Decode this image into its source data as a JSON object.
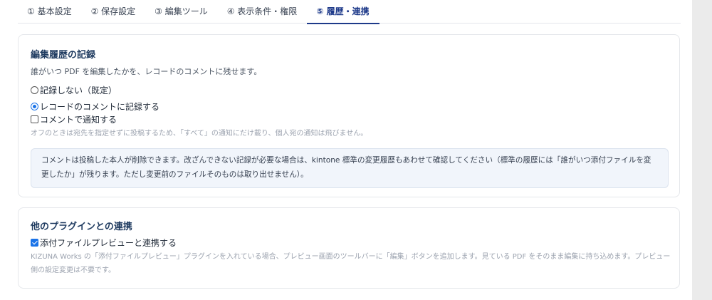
{
  "tabs": [
    {
      "label": "① 基本設定",
      "active": false
    },
    {
      "label": "② 保存設定",
      "active": false
    },
    {
      "label": "③ 編集ツール",
      "active": false
    },
    {
      "label": "④ 表示条件・権限",
      "active": false
    },
    {
      "label": "⑤ 履歴・連携",
      "active": true
    }
  ],
  "history": {
    "title": "編集履歴の記録",
    "description": "誰がいつ PDF を編集したかを、レコードのコメントに残せます。",
    "options": {
      "no_record": {
        "label": "記録しない（既定）",
        "checked": false
      },
      "record_comment": {
        "label": "レコードのコメントに記録する",
        "checked": true
      },
      "notify_comment": {
        "label": "コメントで通知する",
        "checked": false
      }
    },
    "hint": "オフのときは宛先を指定せずに投稿するため、「すべて」の通知にだけ載り、個人宛の通知は飛びません。",
    "note": "コメントは投稿した本人が削除できます。改ざんできない記録が必要な場合は、kintone 標準の変更履歴もあわせて確認してください（標準の履歴には「誰がいつ添付ファイルを変更したか」が残ります。ただし変更前のファイルそのものは取り出せません）。"
  },
  "integration": {
    "title": "他のプラグインとの連携",
    "option": {
      "label": "添付ファイルプレビューと連携する",
      "checked": true
    },
    "hint": "KIZUNA Works の「添付ファイルプレビュー」プラグインを入れている場合、プレビュー画面のツールバーに「編集」ボタンを追加します。見ている PDF をそのまま編集に持ち込めます。プレビュー側の設定変更は不要です。"
  },
  "colors": {
    "accent": "#1e3a8a",
    "checkbox": "#1a73e8",
    "note_bg": "#f1f5fb"
  }
}
